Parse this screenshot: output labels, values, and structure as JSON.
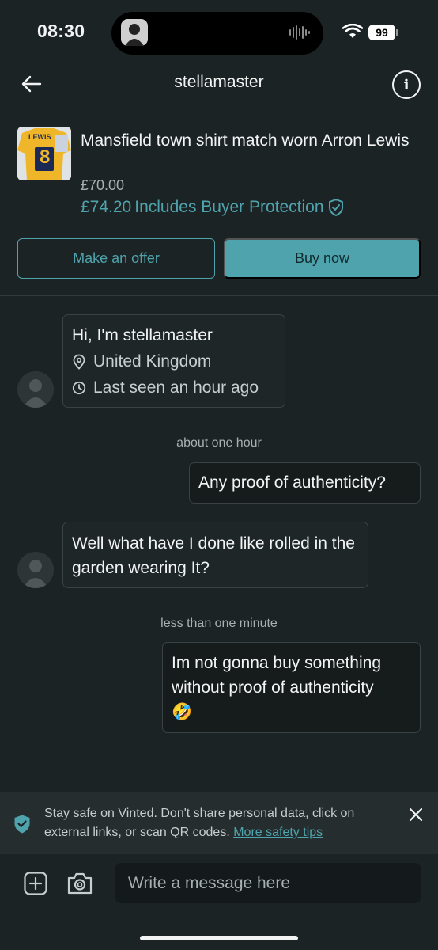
{
  "status_bar": {
    "time": "08:30",
    "battery": "99"
  },
  "header": {
    "title": "stellamaster"
  },
  "item": {
    "title": "Mansfield town shirt match worn Arron Lewis",
    "price": "£70.00",
    "total": "£74.20",
    "protection": "Includes Buyer Protection",
    "thumb_shirt_name": "LEWIS",
    "thumb_shirt_number": "8"
  },
  "actions": {
    "offer_label": "Make an offer",
    "buy_label": "Buy now"
  },
  "profile": {
    "greeting": "Hi, I'm stellamaster",
    "location": "United Kingdom",
    "last_seen": "Last seen an hour ago"
  },
  "messages": {
    "ts1": "about one hour",
    "out1": "Any proof of authenticity?",
    "in1": "Well what have I done like rolled in the garden wearing It?",
    "ts2": "less than one minute",
    "out2": "Im not gonna buy something without proof of authenticity",
    "out2_emoji": "🤣"
  },
  "safety": {
    "text": "Stay safe on Vinted. Don't share personal data, click on external links, or scan QR codes.",
    "link": "More safety tips"
  },
  "composer": {
    "placeholder": "Write a message here"
  },
  "colors": {
    "accent": "#4fa3ad",
    "background": "#1c2324"
  },
  "icons": [
    "back-arrow-icon",
    "info-icon",
    "shield-check-icon",
    "location-pin-icon",
    "clock-icon",
    "close-icon",
    "add-icon",
    "camera-icon",
    "user-placeholder-icon"
  ]
}
